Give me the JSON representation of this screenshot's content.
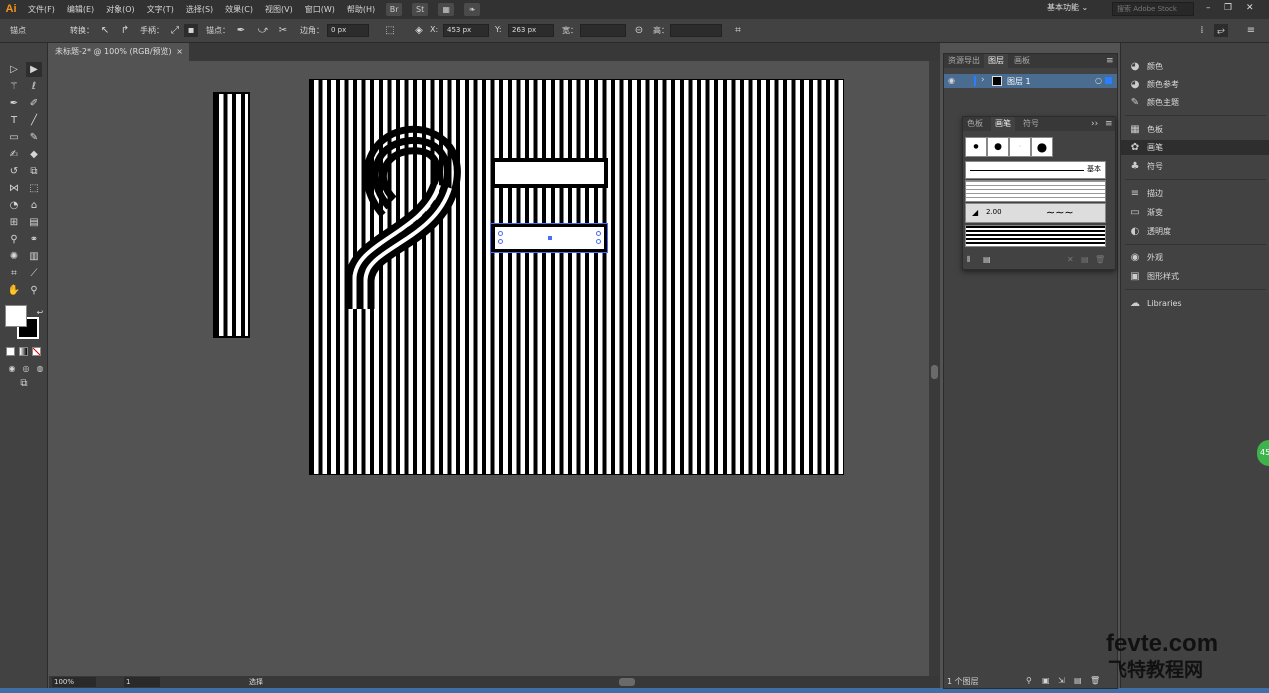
{
  "app": {
    "logo": "Ai"
  },
  "menus": [
    "文件(F)",
    "编辑(E)",
    "对象(O)",
    "文字(T)",
    "选择(S)",
    "效果(C)",
    "视图(V)",
    "窗口(W)",
    "帮助(H)"
  ],
  "menu_badges": {
    "br": "Br",
    "st": "St"
  },
  "workspace": "基本功能",
  "stock_search_placeholder": "搜索 Adobe Stock",
  "controlbar": {
    "mode_label": "锚点",
    "convert_label": "转换：",
    "handle_label": "手柄：",
    "anchor_label": "锚点：",
    "corner_label": "边角：",
    "corner_value": "0 px",
    "x_label": "X:",
    "x_value": "453 px",
    "y_label": "Y:",
    "y_value": "263 px",
    "w_label": "宽：",
    "h_label": "高："
  },
  "document": {
    "tab_title": "未标题-2* @ 100% (RGB/预览)",
    "close": "×"
  },
  "statusbar": {
    "zoom": "100%",
    "page": "1",
    "mode": "选择"
  },
  "layers_panel": {
    "tabs": [
      "资源导出",
      "图层",
      "画板"
    ],
    "active_tab": "图层",
    "layer_name": "图层 1",
    "footer": "1 个图层"
  },
  "brushes_panel": {
    "tabs": [
      "色板",
      "画笔",
      "符号"
    ],
    "active_tab": "画笔",
    "basic_label": "基本",
    "size_label": "2.00"
  },
  "dock": [
    {
      "icon": "color-icon",
      "glyph": "◕",
      "label": "颜色"
    },
    {
      "icon": "color-guide-icon",
      "glyph": "◕",
      "label": "颜色参考"
    },
    {
      "icon": "color-theme-icon",
      "glyph": "✎",
      "label": "颜色主题"
    },
    {
      "icon": "swatches-icon",
      "glyph": "▦",
      "label": "色板"
    },
    {
      "icon": "brushes-icon",
      "glyph": "✿",
      "label": "画笔"
    },
    {
      "icon": "symbols-icon",
      "glyph": "♣",
      "label": "符号"
    },
    {
      "icon": "stroke-icon",
      "glyph": "≡",
      "label": "描边"
    },
    {
      "icon": "gradient-icon",
      "glyph": "▭",
      "label": "渐变"
    },
    {
      "icon": "transparency-icon",
      "glyph": "◐",
      "label": "透明度"
    },
    {
      "icon": "appearance-icon",
      "glyph": "◉",
      "label": "外观"
    },
    {
      "icon": "graphic-styles-icon",
      "glyph": "▣",
      "label": "图形样式"
    },
    {
      "icon": "libraries-icon",
      "glyph": "☁",
      "label": "Libraries"
    }
  ],
  "dock_active": "画笔",
  "badge": "45",
  "watermark": {
    "line1": "fevte.com",
    "line2": "飞特教程网"
  },
  "colors": {
    "ui_dark": "#323232",
    "panel": "#424242",
    "canvas_bg": "#535353",
    "selection": "#4a6c90",
    "accent": "#f7931e"
  }
}
